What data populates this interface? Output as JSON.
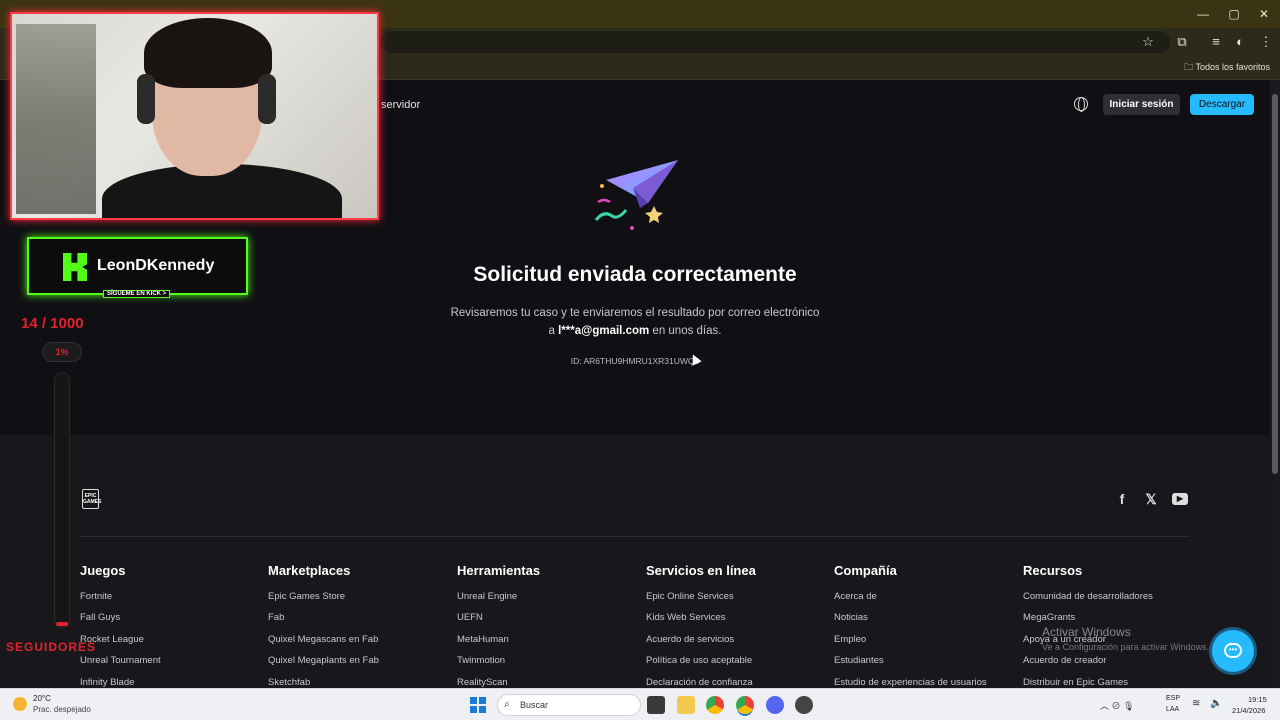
{
  "browser": {
    "bookmarks_label": "Todos los favoritos",
    "window_controls": [
      "minimize-icon",
      "restore-icon",
      "close-icon"
    ],
    "toolbar_icons": [
      "star-icon",
      "extensions-icon",
      "media-icon",
      "profile-icon",
      "menu-icon"
    ]
  },
  "header": {
    "nav_partial": "servidor",
    "login_label": "Iniciar sesión",
    "download_label": "Descargar",
    "accent": "#26bbff"
  },
  "main": {
    "title": "Solicitud enviada correctamente",
    "message_line1": "Revisaremos tu caso y te enviaremos el resultado por correo electrónico",
    "message_prefix": "a",
    "email": "l***a@gmail.com",
    "message_suffix": "en unos días.",
    "request_id": "ID: AR6THU9HMRU1XR31UWQ5"
  },
  "footer": {
    "logo_text": "EPIC GAMES",
    "social": [
      "facebook-icon",
      "x-icon",
      "youtube-icon"
    ],
    "columns": [
      {
        "heading": "Juegos",
        "links": [
          "Fortnite",
          "Fall Guys",
          "Rocket League",
          "Unreal Tournament",
          "Infinity Blade"
        ]
      },
      {
        "heading": "Marketplaces",
        "links": [
          "Epic Games Store",
          "Fab",
          "Quixel Megascans en Fab",
          "Quixel Megaplants en Fab",
          "Sketchfab"
        ]
      },
      {
        "heading": "Herramientas",
        "links": [
          "Unreal Engine",
          "UEFN",
          "MetaHuman",
          "Twinmotion",
          "RealityScan"
        ]
      },
      {
        "heading": "Servicios en línea",
        "links": [
          "Epic Online Services",
          "Kids Web Services",
          "Acuerdo de servicios",
          "Política de uso aceptable",
          "Declaración de confianza"
        ]
      },
      {
        "heading": "Compañía",
        "links": [
          "Acerca de",
          "Noticias",
          "Empleo",
          "Estudiantes",
          "Estudio de experiencias de usuarios"
        ]
      },
      {
        "heading": "Recursos",
        "links": [
          "Comunidad de desarrolladores",
          "MegaGrants",
          "Apoya a un creador",
          "Acuerdo de creador",
          "Distribuir en Epic Games"
        ]
      }
    ]
  },
  "windows_watermark": {
    "line1": "Activar Windows",
    "line2": "Ve a Configuración para activar Windows."
  },
  "overlay": {
    "kick_name": "LeonDKennedy",
    "kick_follow": "SÍGUEME EN KICK >",
    "kick_color": "#53fc18",
    "goal": "14 / 1000",
    "percent": "1%",
    "progress_fraction": 0.014,
    "goal_label": "SEGUIDORES",
    "alert_color": "#e5202e"
  },
  "taskbar": {
    "temperature": "20°C",
    "condition": "Prac. despejado",
    "search_placeholder": "Buscar",
    "lang_line1": "ESP",
    "lang_line2": "LAA",
    "time": "19:15",
    "date": "21/4/2026"
  }
}
